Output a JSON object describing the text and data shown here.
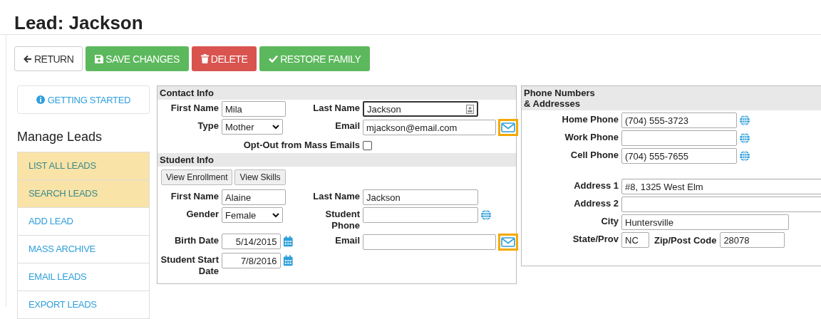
{
  "title": "Lead: Jackson",
  "toolbar": [
    {
      "label": "RETURN",
      "kind": "return"
    },
    {
      "label": "SAVE CHANGES",
      "kind": "save"
    },
    {
      "label": "DELETE",
      "kind": "delete"
    },
    {
      "label": "RESTORE FAMILY",
      "kind": "restore"
    }
  ],
  "sidebar": {
    "getting_started": "GETTING STARTED",
    "heading": "Manage Leads",
    "items": [
      {
        "label": "LIST ALL LEADS",
        "highlighted": true
      },
      {
        "label": "SEARCH LEADS",
        "highlighted": true
      },
      {
        "label": "ADD LEAD",
        "highlighted": false
      },
      {
        "label": "MASS ARCHIVE",
        "highlighted": false
      },
      {
        "label": "EMAIL LEADS",
        "highlighted": false
      },
      {
        "label": "EXPORT LEADS",
        "highlighted": false
      }
    ]
  },
  "contact_info": {
    "title": "Contact Info",
    "fields": [
      {
        "label": "First Name",
        "kind": "text",
        "value": "Mila",
        "focused": false
      },
      {
        "label": "Last Name",
        "kind": "text",
        "value": "Jackson",
        "focused": true
      },
      {
        "label": "Type",
        "kind": "select",
        "value": "Mother"
      },
      {
        "label": "Email",
        "kind": "email",
        "value": "mjackson@email.com",
        "outlined": true
      },
      {
        "label": "Opt-Out from Mass Emails",
        "kind": "checkbox",
        "checked": false
      }
    ]
  },
  "student_info": {
    "title": "Student Info",
    "buttons": [
      "View Enrollment",
      "View Skills"
    ],
    "fields": [
      {
        "label": "First Name",
        "kind": "text",
        "value": "Alaine",
        "focused": false
      },
      {
        "label": "Last Name",
        "kind": "text",
        "value": "Jackson",
        "focused": false
      },
      {
        "label": "Gender",
        "kind": "select",
        "value": "Female"
      },
      {
        "label": "Student Phone",
        "kind": "phone"
      },
      {
        "label": "Birth Date",
        "kind": "date",
        "value": "5/14/2015"
      },
      {
        "label": "Email",
        "kind": "email",
        "outlined": true
      },
      {
        "label": "Student Start Date",
        "kind": "date",
        "value": "7/8/2016"
      }
    ]
  },
  "phones_addresses": {
    "title": "Phone Numbers & Addresses",
    "phones": [
      {
        "label": "Home Phone",
        "value": "(704) 555-3723"
      },
      {
        "label": "Work Phone"
      },
      {
        "label": "Cell Phone",
        "value": "(704) 555-7655"
      }
    ],
    "addresses": [
      {
        "label": "Address 1",
        "value": "#8, 1325 West Elm",
        "kind": "line"
      },
      {
        "label": "Address 2",
        "kind": "line"
      },
      {
        "label": "City",
        "value": "Huntersville",
        "kind": "city"
      }
    ],
    "state_zip": [
      {
        "label": "State/Prov",
        "value": "NC"
      },
      {
        "label": "Zip/Post Code",
        "value": "28078"
      }
    ]
  }
}
